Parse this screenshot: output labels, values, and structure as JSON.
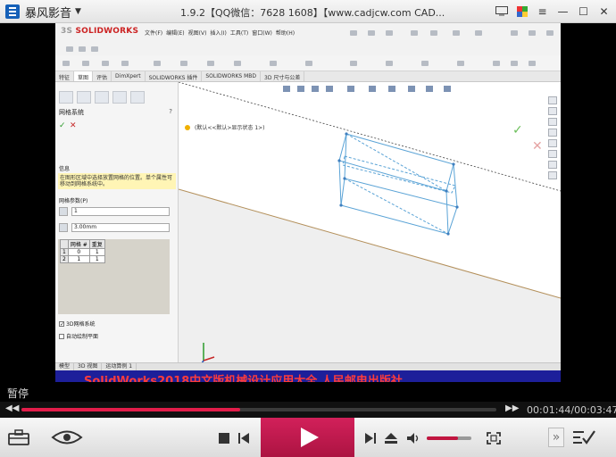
{
  "player": {
    "name": "暴风影音",
    "title": "1.9.2【QQ微信：7628 1608】【www.cadjcw.com CAD...",
    "status": "暂停",
    "time": "00:01:44/00:03:47",
    "progress": 0.46,
    "volume": 0.7
  },
  "solidworks": {
    "logo": "SOLIDWORKS",
    "menu": [
      "文件(F)",
      "编辑(E)",
      "视图(V)",
      "插入(I)",
      "工具(T)",
      "窗口(W)",
      "帮助(H)"
    ],
    "tabs": [
      "特征",
      "草图",
      "评估",
      "DimXpert",
      "SOLIDWORKS 插件",
      "SOLIDWORKS MBD",
      "3D 尺寸与公差"
    ],
    "tree_item": "(默认<<默认>显示状态 1>)",
    "bottom_tabs": [
      "模型",
      "3D 视图",
      "运动算例 1"
    ]
  },
  "pm": {
    "title": "网格系统",
    "help": "?",
    "message_header": "信息",
    "message": "在图形区域中选择放置网格的位置。单个属性可移动到网格系统中。",
    "params_header": "网格参数(P)",
    "count": "1",
    "distance": "3.00mm",
    "table_headers": [
      "网格 #",
      "重复"
    ],
    "table_rows": [
      [
        "0",
        "1"
      ],
      [
        "1",
        "1"
      ]
    ],
    "check1": "3D网格系统",
    "check2": "自动绘制平面"
  },
  "subtitle": "SolidWorks2018中文版机械设计应用大全  人民邮电出版社"
}
